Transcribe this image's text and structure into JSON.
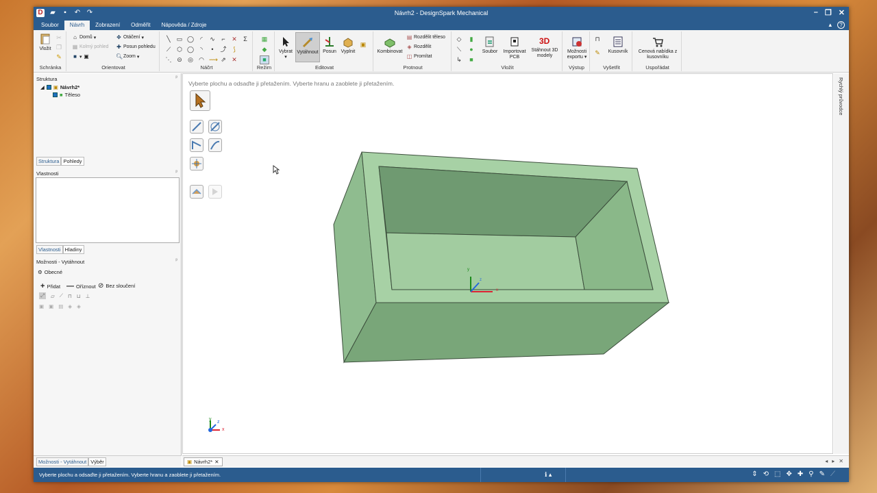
{
  "window": {
    "title": "Návrh2 - DesignSpark Mechanical",
    "controls": {
      "minimize": "–",
      "maximize": "❐",
      "close": "✕"
    }
  },
  "qat_icons": [
    "app-logo-icon",
    "open-icon",
    "save-icon",
    "undo-icon",
    "redo-icon"
  ],
  "menu": {
    "tabs": [
      "Soubor",
      "Návrh",
      "Zobrazení",
      "Odměřit",
      "Nápověda / Zdroje"
    ],
    "active": "Návrh",
    "right": {
      "collapse": "▴",
      "help": "?"
    }
  },
  "ribbon": {
    "clipboard": {
      "label": "Schránka",
      "paste": "Vložit"
    },
    "orient": {
      "label": "Orientovat",
      "home": "Domů",
      "perp": "Kolmý pohled",
      "rotate": "Otáčení",
      "pan": "Posun pohledu",
      "zoom": "Zoom"
    },
    "sketch": {
      "label": "Náčrt"
    },
    "mode": {
      "label": "Režim"
    },
    "edit": {
      "label": "Editovat",
      "select": "Vybrat",
      "pull": "Vytáhnout",
      "move": "Posun",
      "fill": "Vyplnit"
    },
    "intersect": {
      "label": "Protnout",
      "combine": "Kombinovat",
      "split_body": "Rozdělit těleso",
      "split": "Rozdělit",
      "project": "Promítat"
    },
    "insert": {
      "label": "Vložit",
      "file": "Soubor",
      "import_pcb": "Importovat PCB",
      "download_3d": "Stáhnout 3D modely"
    },
    "output": {
      "label": "Výstup",
      "export": "Možnosti exportu"
    },
    "investigate": {
      "label": "Vyšetřit",
      "bom": "Kusovník"
    },
    "arrange": {
      "label": "Uspořádat",
      "quote": "Cenová nabídka z kusovníku"
    }
  },
  "left": {
    "structure_header": "Struktura",
    "tree": {
      "root": "Návrh2*",
      "child": "Těleso"
    },
    "tabs1": [
      "Struktura",
      "Pohledy"
    ],
    "props_header": "Vlastnosti",
    "tabs2": [
      "Vlastnosti",
      "Hladiny"
    ],
    "options_header": "Možnosti - Vytáhnout",
    "general": "Obecné",
    "add": "Přidat",
    "cut": "Oříznout",
    "no_merge": "Bez sloučení",
    "bottom_tabs": [
      "Možnosti - Vytáhnout",
      "Výběr"
    ]
  },
  "canvas": {
    "hint": "Vyberte plochu a odsaďte ji přetažením. Vyberte hranu a zaoblete ji přetažením.",
    "axis": {
      "x": "x",
      "y": "y",
      "z": "z"
    }
  },
  "right_panel": "Rychlý průvodce",
  "doc_tab": {
    "name": "Návrh2*",
    "close": "✕"
  },
  "doc_nav": {
    "prev": "◂",
    "next": "▸",
    "close": "✕"
  },
  "status": {
    "message": "Vyberte plochu a odsaďte ji přetažením. Vyberte hranu a zaoblete ji přetažením.",
    "info": "ℹ ▴"
  },
  "colors": {
    "titlebar": "#2b5c8e",
    "body_face": "#9dc99d",
    "inner_dark": "#6f9a71"
  }
}
